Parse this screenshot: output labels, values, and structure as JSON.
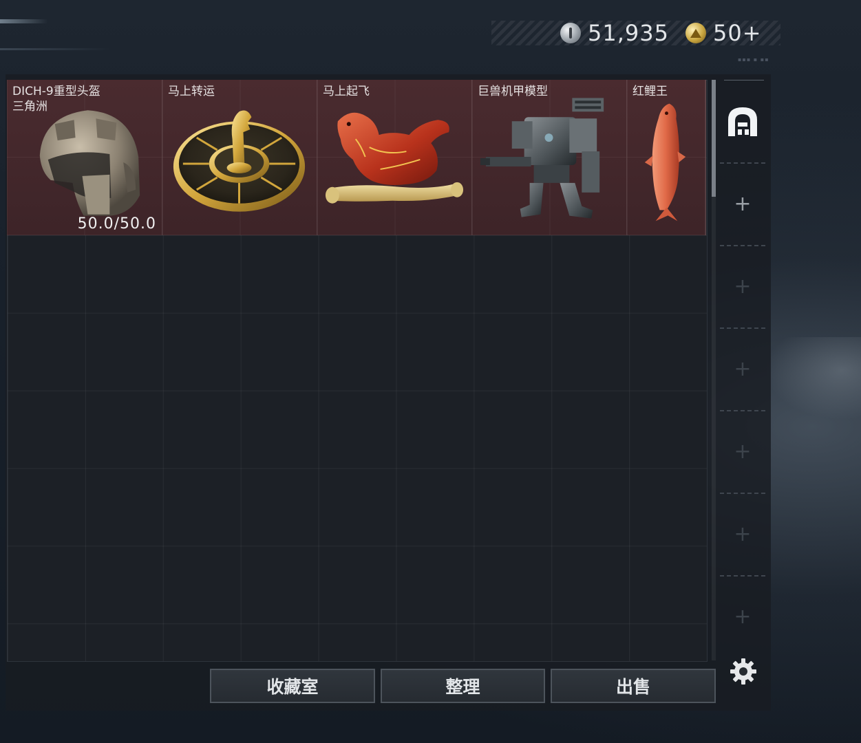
{
  "currency": {
    "silver": {
      "amount": "51,935",
      "icon": "silver-coin-icon"
    },
    "gold": {
      "amount": "50+",
      "icon": "gold-coin-icon"
    }
  },
  "tiny_label": "▪▪▪ ▪ ▪▪",
  "items": [
    {
      "name": "DICH-9重型头盔",
      "sub": "三角洲",
      "durability": "50.0/50.0",
      "art": "helmet"
    },
    {
      "name": "马上转运",
      "art": "gold-wheel-horse"
    },
    {
      "name": "马上起飞",
      "art": "red-horse"
    },
    {
      "name": "巨兽机甲模型",
      "art": "mech"
    },
    {
      "name": "红鲤王",
      "art": "red-carp"
    }
  ],
  "side": {
    "backpack_icon": "backpack-icon",
    "slots": [
      "+",
      "+",
      "+",
      "+",
      "+",
      "+"
    ]
  },
  "buttons": {
    "collection": "收藏室",
    "sort": "整理",
    "sell": "出售"
  },
  "icons": {
    "settings": "gear-icon"
  },
  "colors": {
    "item_bg": "#4a2b2f",
    "grid_bg": "#1c2026"
  }
}
